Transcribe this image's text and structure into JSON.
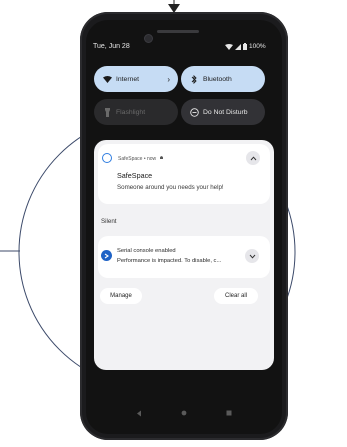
{
  "status_bar": {
    "date": "Tue, Jun 28",
    "battery": "100%"
  },
  "quick_settings": {
    "internet": {
      "label": "Internet",
      "icon": "wifi-icon"
    },
    "bluetooth": {
      "label": "Bluetooth",
      "icon": "bluetooth-icon"
    },
    "flashlight": {
      "label": "Flashlight",
      "icon": "flashlight-icon"
    },
    "dnd": {
      "label": "Do Not Disturb",
      "icon": "do-not-disturb-icon"
    }
  },
  "notifications": {
    "safespace": {
      "header": "SafeSpace • now",
      "title": "SafeSpace",
      "body": "Someone around you needs your help!"
    },
    "silent_label": "Silent",
    "serial": {
      "title": "Serial console enabled",
      "body": "Performance is impacted. To disable, c..."
    },
    "manage_label": "Manage",
    "clear_all_label": "Clear all"
  },
  "colors": {
    "accent": "#2f7de0",
    "tile_active": "#c6dcf4",
    "panel_bg": "#f2f2f4"
  }
}
